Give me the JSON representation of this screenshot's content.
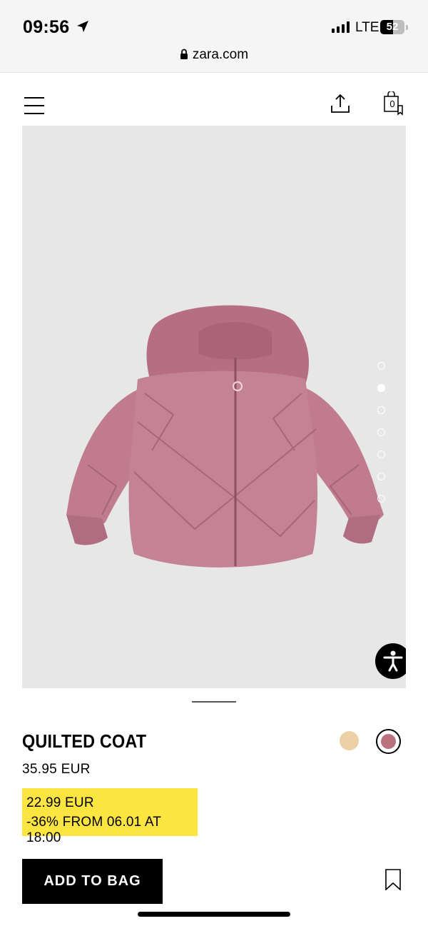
{
  "status_bar": {
    "time": "09:56",
    "network": "LTE",
    "battery": "52",
    "battery_level_percent": 52
  },
  "browser": {
    "url": "zara.com"
  },
  "header": {
    "bag_count": "0",
    "icons": [
      "menu-icon",
      "share-icon",
      "shopping-bag-icon"
    ]
  },
  "gallery": {
    "image_count": 7,
    "active_index": 1
  },
  "product": {
    "name": "QUILTED COAT",
    "price": "35.95 EUR",
    "promo_price": "22.99 EUR",
    "promo_text": "-36% FROM 06.01 AT 18:00",
    "colors": [
      {
        "hex": "#ecd0a6",
        "selected": false
      },
      {
        "hex": "#b9727e",
        "selected": true
      }
    ]
  },
  "actions": {
    "add_to_bag": "ADD TO BAG"
  },
  "colors": {
    "promo_highlight": "#fce540",
    "image_background": "#e7e7e7",
    "jacket": "#c07c8e"
  }
}
